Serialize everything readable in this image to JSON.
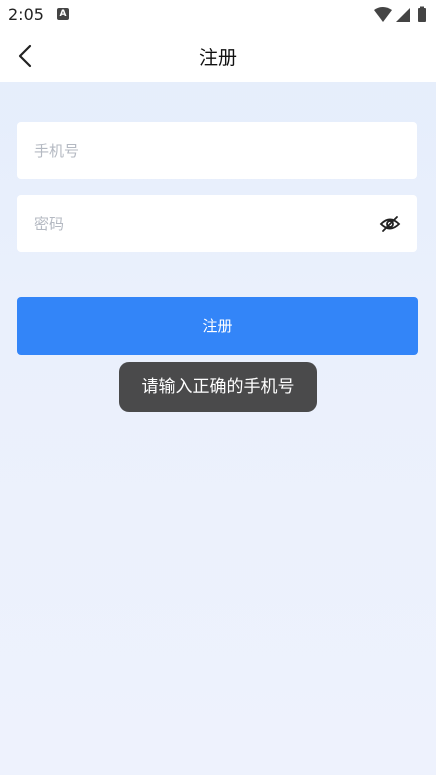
{
  "status_bar": {
    "time": "2:05",
    "notification_icon": "a-icon",
    "right_icons": [
      "wifi-icon",
      "cell-signal-icon",
      "battery-icon"
    ]
  },
  "nav": {
    "title": "注册",
    "back_icon": "chevron-left-icon"
  },
  "form": {
    "phone_placeholder": "手机号",
    "phone_value": "",
    "password_placeholder": "密码",
    "password_value": "",
    "password_toggle_icon": "eye-hidden-icon",
    "submit_label": "注册"
  },
  "toast": {
    "message": "请输入正确的手机号"
  },
  "colors": {
    "accent": "#3385f8",
    "background_top": "#e4edfb",
    "background_bottom": "#eef2fd",
    "toast_bg": "#3c3c3c"
  }
}
